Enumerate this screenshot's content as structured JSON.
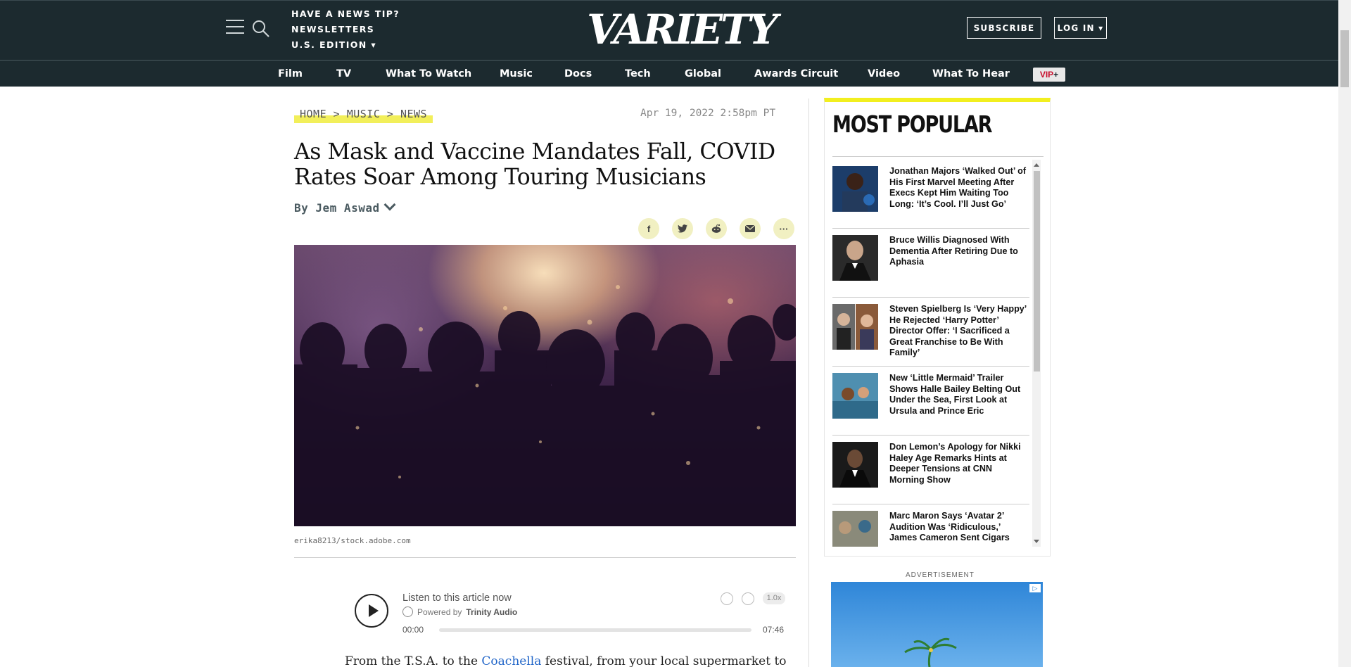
{
  "header": {
    "top_links": [
      "HAVE A NEWS TIP?",
      "NEWSLETTERS",
      "U.S. EDITION ▾"
    ],
    "logo_text": "VARIETY",
    "subscribe_label": "SUBSCRIBE",
    "login_label": "LOG IN ▾"
  },
  "nav": {
    "items": [
      "Film",
      "TV",
      "What To Watch",
      "Music",
      "Docs",
      "Tech",
      "Global",
      "Awards Circuit",
      "Video",
      "What To Hear"
    ],
    "vip_label": "VIP",
    "vip_plus": "+"
  },
  "article": {
    "breadcrumb": "HOME > MUSIC > NEWS",
    "date": "Apr 19, 2022 2:58pm PT",
    "headline": "As Mask and Vaccine Mandates Fall, COVID Rates Soar Among Touring Musicians",
    "byline": "By Jem Aswad",
    "share": {
      "facebook": "f",
      "more": "···"
    },
    "image_credit": "erika8213/stock.adobe.com",
    "body_start": "From the T.S.A. to the ",
    "body_link": "Coachella",
    "body_end": " festival, from your local supermarket to"
  },
  "player": {
    "title": "Listen to this article now",
    "powered_by": "Powered by",
    "provider": "Trinity Audio",
    "current_time": "00:00",
    "duration": "07:46",
    "speed": "1.0x",
    "progress": 0
  },
  "sidebar": {
    "title": "MOST POPULAR",
    "items": [
      {
        "text": "Jonathan Majors ‘Walked Out’ of His First Marvel Meeting After Execs Kept Him Waiting Too Long: ‘It’s Cool. I’ll Just Go’"
      },
      {
        "text": "Bruce Willis Diagnosed With Dementia After Retiring Due to Aphasia"
      },
      {
        "text": "Steven Spielberg Is ‘Very Happy’ He Rejected ‘Harry Potter’ Director Offer: ‘I Sacrificed a Great Franchise to Be With Family’"
      },
      {
        "text": "New ‘Little Mermaid’ Trailer Shows Halle Bailey Belting Out Under the Sea, First Look at Ursula and Prince Eric"
      },
      {
        "text": "Don Lemon’s Apology for Nikki Haley Age Remarks Hints at Deeper Tensions at CNN Morning Show"
      },
      {
        "text": "Marc Maron Says ‘Avatar 2’ Audition Was ‘Ridiculous,’ James Cameron Sent Cigars"
      }
    ],
    "ad_label": "ADVERTISEMENT"
  },
  "colors": {
    "header_bg": "#1c2a2f",
    "accent_yellow": "#f2ef1f",
    "link_blue": "#1f64c8",
    "vip_red": "#c8102e"
  }
}
